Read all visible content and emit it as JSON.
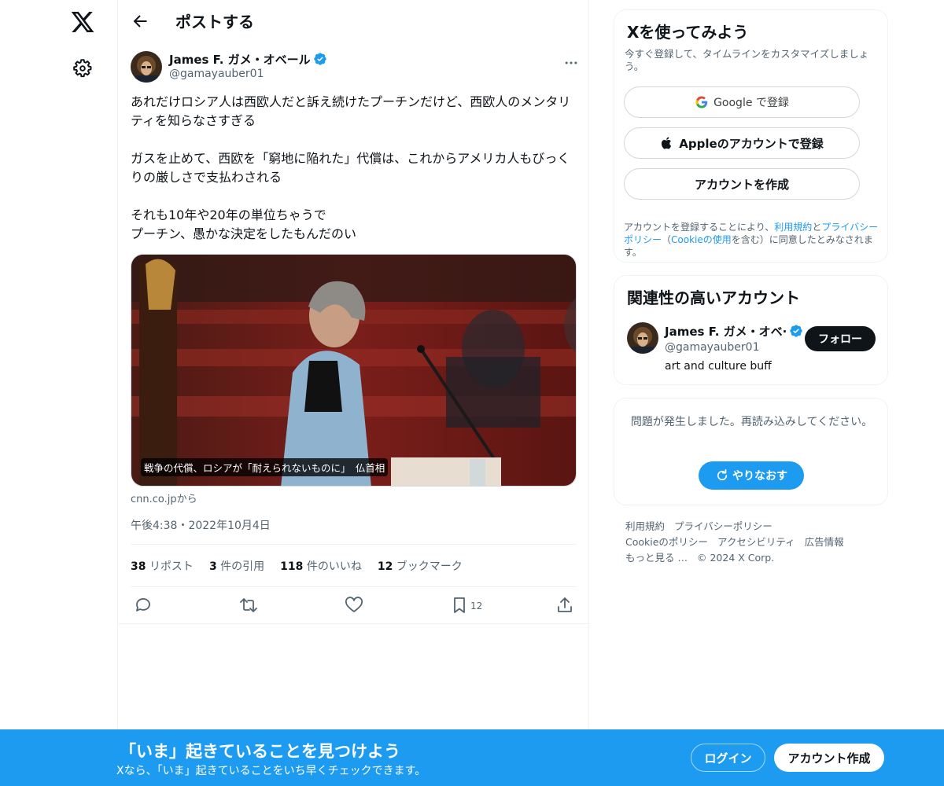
{
  "header": {
    "title": "ポストする"
  },
  "tweet": {
    "author_name": "James F. ガメ・オベール",
    "author_handle": "@gamayauber01",
    "text": "あれだけロシア人は西欧人だと訴え続けたプーチンだけど、西欧人のメンタリティを知らなさすぎる\n\nガスを止めて、西欧を「窮地に陥れた」代償は、これからアメリカ人もびっくりの厳しさで支払わされる\n\nそれも10年や20年の単位ちゃうで\nプーチン、愚かな決定をしたもんだのい",
    "card_caption": "戦争の代償、ロシアが「耐えられないものに」　仏首相",
    "card_source": "cnn.co.jpから",
    "timestamp": "午後4:38・2022年10月4日",
    "stats": {
      "reposts_count": "38",
      "reposts_label": "リポスト",
      "quotes_count": "3",
      "quotes_label": "件の引用",
      "likes_count": "118",
      "likes_label": "件のいいね",
      "bookmarks_count": "12",
      "bookmarks_label": "ブックマーク"
    },
    "bookmark_action_count": "12"
  },
  "signup": {
    "title": "Xを使ってみよう",
    "subtitle": "今すぐ登録して、タイムラインをカスタマイズしましょう。",
    "google_label": "Google で登録",
    "apple_label": "Appleのアカウントで登録",
    "create_label": "アカウントを作成",
    "terms_pre": "アカウントを登録することにより、",
    "terms_link1": "利用規約",
    "terms_mid1": "と",
    "terms_link2": "プライバシーポリシー",
    "terms_mid2": "（",
    "terms_link3": "Cookieの使用",
    "terms_post": "を含む）に同意したとみなされます。"
  },
  "related": {
    "title": "関連性の高いアカウント",
    "name": "James F. ガメ・オベ·",
    "handle": "@gamayauber01",
    "bio": "art and culture buff",
    "follow_label": "フォロー"
  },
  "error_panel": {
    "message": "問題が発生しました。再読み込みしてください。",
    "retry_label": "やりなおす"
  },
  "footer": {
    "links": [
      "利用規約",
      "プライバシーポリシー",
      "Cookieのポリシー",
      "アクセシビリティ",
      "広告情報",
      "もっと見る …",
      "© 2024 X Corp."
    ]
  },
  "banner": {
    "title": "「いま」起きていることを見つけよう",
    "subtitle": "Xなら、「いま」起きていることをいち早くチェックできます。",
    "login_label": "ログイン",
    "create_label": "アカウント作成"
  },
  "colors": {
    "accent": "#1d9bf0",
    "text": "#0f1419",
    "muted": "#536471",
    "border": "#eff3f4"
  }
}
